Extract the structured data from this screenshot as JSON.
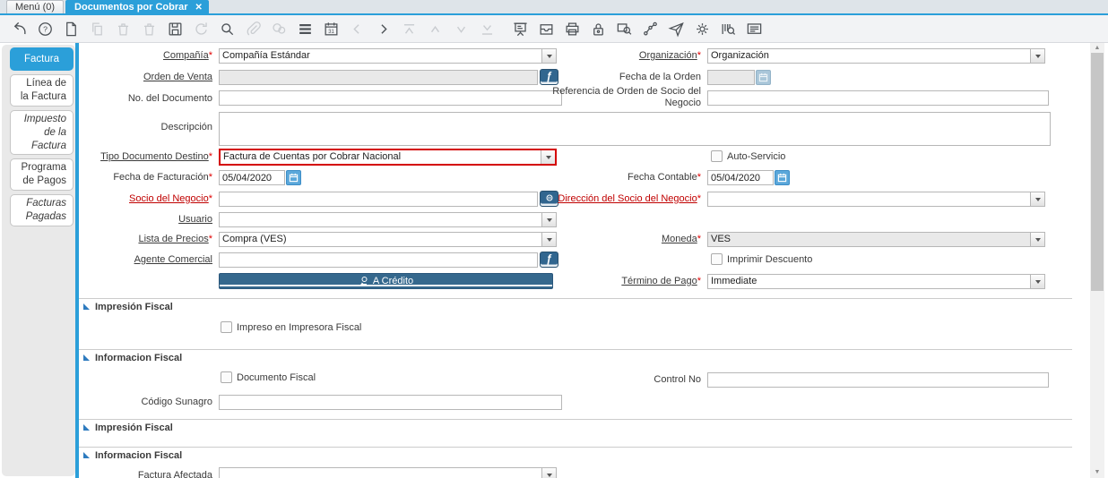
{
  "tabbar": {
    "menu_tab": "Menú (0)",
    "active_tab": "Documentos por Cobrar"
  },
  "toolbar": {
    "buttons": [
      {
        "name": "undo",
        "enabled": true
      },
      {
        "name": "help",
        "enabled": true
      },
      {
        "name": "new-record",
        "enabled": true
      },
      {
        "name": "copy-record",
        "enabled": false
      },
      {
        "name": "delete-record",
        "enabled": false
      },
      {
        "name": "delete-selection",
        "enabled": false
      },
      {
        "name": "save",
        "enabled": true
      },
      {
        "name": "requery",
        "enabled": false
      },
      {
        "name": "find",
        "enabled": true
      },
      {
        "name": "attachment",
        "enabled": false
      },
      {
        "name": "chat",
        "enabled": false
      },
      {
        "name": "toggle-grid",
        "enabled": true
      },
      {
        "name": "calendar",
        "enabled": true
      },
      {
        "name": "parent-record",
        "enabled": false
      },
      {
        "name": "detail-record",
        "enabled": true
      },
      {
        "name": "first-record",
        "enabled": false
      },
      {
        "name": "previous-record",
        "enabled": false
      },
      {
        "name": "next-record",
        "enabled": false
      },
      {
        "name": "last-record",
        "enabled": false
      },
      {
        "name": "report",
        "enabled": true
      },
      {
        "name": "archive",
        "enabled": true
      },
      {
        "name": "print",
        "enabled": true
      },
      {
        "name": "lock",
        "enabled": true
      },
      {
        "name": "zoom-across",
        "enabled": true
      },
      {
        "name": "workflow",
        "enabled": true
      },
      {
        "name": "request",
        "enabled": true
      },
      {
        "name": "preferences",
        "enabled": true
      },
      {
        "name": "product-info",
        "enabled": true
      },
      {
        "name": "window-help",
        "enabled": true
      }
    ],
    "calendar_day": "31"
  },
  "sidebar": {
    "items": [
      {
        "label": "Factura",
        "active": true
      },
      {
        "label": "Línea de la Factura",
        "active": false
      },
      {
        "label": "Impuesto de la Factura",
        "active": false,
        "italic": true
      },
      {
        "label": "Programa de Pagos",
        "active": false
      },
      {
        "label": "Facturas Pagadas",
        "active": false,
        "italic": true
      }
    ]
  },
  "form": {
    "compania": {
      "label": "Compañía",
      "value": "Compañía Estándar"
    },
    "organizacion": {
      "label": "Organización",
      "value": "Organización"
    },
    "orden_venta": {
      "label": "Orden de Venta",
      "value": ""
    },
    "fecha_orden": {
      "label": "Fecha de la Orden",
      "value": ""
    },
    "no_documento": {
      "label": "No. del Documento",
      "value": ""
    },
    "referencia": {
      "label": "Referencia de Orden de Socio del Negocio",
      "value": ""
    },
    "descripcion": {
      "label": "Descripción",
      "value": ""
    },
    "tipo_documento": {
      "label": "Tipo Documento Destino",
      "value": "Factura de Cuentas por Cobrar Nacional"
    },
    "auto_servicio": {
      "label": "Auto-Servicio",
      "checked": false
    },
    "fecha_facturacion": {
      "label": "Fecha de Facturación",
      "value": "05/04/2020"
    },
    "fecha_contable": {
      "label": "Fecha Contable",
      "value": "05/04/2020"
    },
    "socio_negocio": {
      "label": "Socio del Negocio",
      "value": ""
    },
    "direccion_socio": {
      "label": "Dirección del Socio del Negocio",
      "value": ""
    },
    "usuario": {
      "label": "Usuario",
      "value": ""
    },
    "lista_precios": {
      "label": "Lista de Precios",
      "value": "Compra (VES)"
    },
    "moneda": {
      "label": "Moneda",
      "value": "VES"
    },
    "agente_comercial": {
      "label": "Agente Comercial",
      "value": ""
    },
    "imprimir_descuento": {
      "label": "Imprimir Descuento",
      "checked": false
    },
    "a_credito": {
      "label": "A Crédito"
    },
    "termino_pago": {
      "label": "Término de Pago",
      "value": "Immediate"
    },
    "impreso_impresora": {
      "label": "Impreso en Impresora Fiscal",
      "checked": false
    },
    "documento_fiscal": {
      "label": "Documento Fiscal",
      "checked": false
    },
    "control_no": {
      "label": "Control No",
      "value": ""
    },
    "codigo_sunagro": {
      "label": "Código Sunagro",
      "value": ""
    },
    "factura_afectada": {
      "label": "Factura Afectada",
      "value": ""
    }
  },
  "sections": {
    "s1": "Impresión Fiscal",
    "s2": "Informacion Fiscal",
    "s3": "Impresión Fiscal",
    "s4": "Informacion Fiscal"
  },
  "ui": {
    "req": "*",
    "close": "✕",
    "zoom_glyph": "ƒ",
    "scroll_up": "▲",
    "scroll_down": "▼"
  },
  "colors": {
    "accent": "#2b9fd9",
    "action_button": "#31668f",
    "highlight_border": "#d40000",
    "missing_mandatory_label": "#c00000"
  }
}
